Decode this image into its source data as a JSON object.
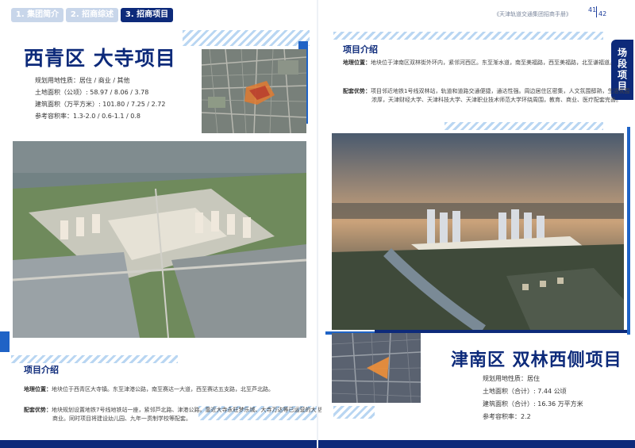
{
  "tabs": [
    "1. 集团简介",
    "2. 招商综述",
    "3. 招商项目"
  ],
  "header_right": "《天津轨道交通集团招商手册》",
  "page_numbers": [
    "41",
    "42"
  ],
  "side_badge": "场段项目",
  "project1": {
    "title": "西青区  大寺项目",
    "specs": [
      "规划用地性质：居住 / 商业 / 其他",
      "土地面积（公顷）: 58.97 / 8.06 / 3.78",
      "建筑面积（万平方米）: 101.80 / 7.25 / 2.72",
      "参考容积率：1.3-2.0 / 0.6-1.1 / 0.8"
    ],
    "intro_title": "项目介绍",
    "location_label": "地理位置：",
    "location_text": "地块位于西青区大寺镇。东至津港公路，南至赛达一大道，西至赛达五支路，北至芦北路。",
    "advantage_label": "配套优势：",
    "advantage_text": "地块规划设置地铁7号线地铁站一座，紧邻芦北路、津港公路。靠近大寺永旺梦乐城、大寺万达等已运营的大型商业。同时项目将建设幼儿园、九年一贯制学校等配套。"
  },
  "project2": {
    "title": "津南区  双林西侧项目",
    "specs": [
      "规划用地性质：居住",
      "土地面积（合计）: 7.44 公顷",
      "建筑面积（合计）: 16.36 万平方米",
      "参考容积率：2.2"
    ],
    "intro_title": "项目介绍",
    "location_label": "地理位置：",
    "location_text": "地块位于津南区双林街外环内，紧邻河西区。东至渐水道，南至美福路，西至美福路，北至谦福道。",
    "advantage_label": "配套优势：",
    "advantage_text": "项目邻近地铁1号线双林站，轨道和道路交通便捷，通达性强。周边居住区密集，人文氛围醇熟，生活氛围浓厚，天津财经大学、天津科技大学、天津职业技术师范大学环绕周围，教育、商业、医疗配套完善。"
  },
  "colors": {
    "navy": "#0d2a7a",
    "blue": "#1f63c6",
    "light_blue": "#b9d6f2"
  }
}
